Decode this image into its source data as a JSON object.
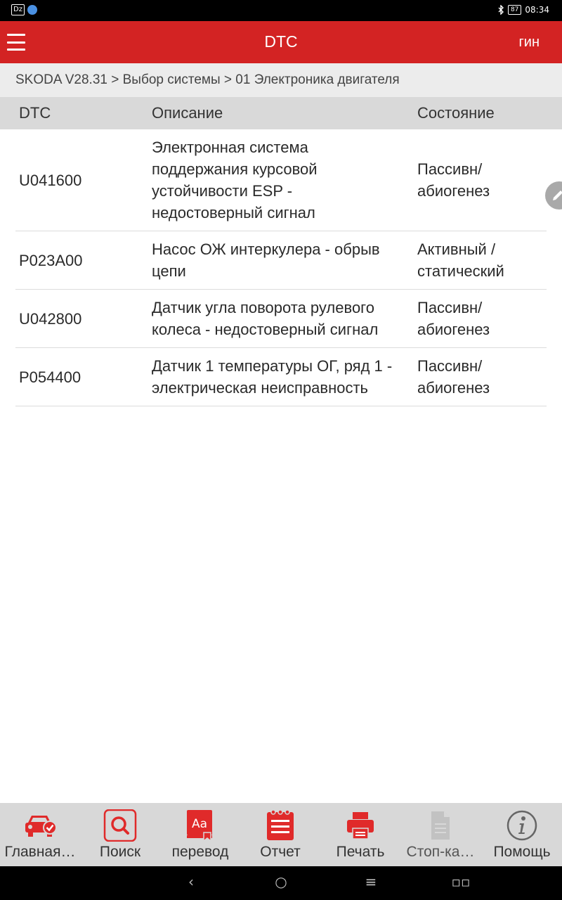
{
  "status_bar": {
    "left_badge": "Dz",
    "battery": "87",
    "time": "08:34",
    "bluetooth_icon": "bluetooth-icon"
  },
  "app_bar": {
    "title": "DTC",
    "right_action": "гин"
  },
  "breadcrumb": "SKODA V28.31 > Выбор системы > 01 Электроника двигателя",
  "table": {
    "headers": {
      "code": "DTC",
      "description": "Описание",
      "state": "Состояние"
    },
    "rows": [
      {
        "code": "U041600",
        "description": "Электронная система поддержания курсовой устойчивости ESP - недостоверный сигнал",
        "state": "Пассивн/ абиогенез"
      },
      {
        "code": "P023A00",
        "description": "Насос ОЖ интеркулера - обрыв цепи",
        "state": "Активный / статический"
      },
      {
        "code": "U042800",
        "description": "Датчик угла поворота рулевого колеса - недостоверный сигнал",
        "state": "Пассивн/ абиогенез"
      },
      {
        "code": "P054400",
        "description": "Датчик 1 температуры ОГ, ряд 1 - электрическая неисправность",
        "state": "Пассивн/ абиогенез"
      }
    ]
  },
  "toolbar": {
    "items": [
      {
        "label": "Главная…",
        "icon": "car-check-icon"
      },
      {
        "label": "Поиск",
        "icon": "search-icon"
      },
      {
        "label": "перевод",
        "icon": "translate-icon"
      },
      {
        "label": "Отчет",
        "icon": "report-icon"
      },
      {
        "label": "Печать",
        "icon": "printer-icon"
      },
      {
        "label": "Стоп-ка…",
        "icon": "document-icon"
      },
      {
        "label": "Помощь",
        "icon": "info-icon"
      }
    ]
  },
  "colors": {
    "accent": "#d32323",
    "header_bg": "#d9d9d9",
    "toolbar_bg": "#d8d8d8"
  }
}
